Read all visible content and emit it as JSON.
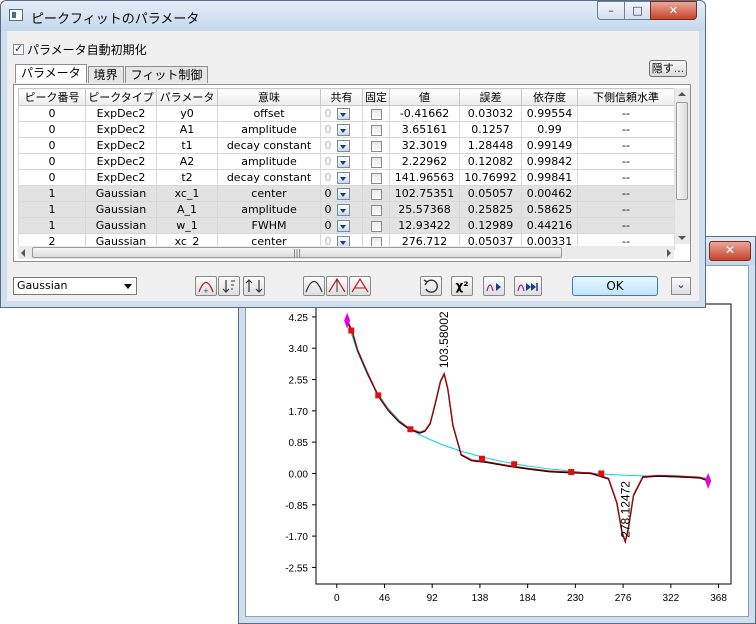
{
  "dialog": {
    "title": "ピークフィットのパラメータ",
    "auto_init_label": "パラメータ自動初期化",
    "hide_label": "隠す...",
    "tabs": [
      "パラメータ",
      "境界",
      "フィット制御"
    ],
    "columns": [
      "ピーク番号",
      "ピークタイプ",
      "パラメータ",
      "意味",
      "共有",
      "固定",
      "値",
      "誤差",
      "依存度",
      "下側信頼水準"
    ],
    "rows": [
      {
        "peak": "0",
        "type": "ExpDec2",
        "param": "y0",
        "meaning": "offset",
        "share": "0",
        "value": "-0.41662",
        "error": "0.03032",
        "dep": "0.99554",
        "lcl": "--",
        "shade": false
      },
      {
        "peak": "0",
        "type": "ExpDec2",
        "param": "A1",
        "meaning": "amplitude",
        "share": "0",
        "value": "3.65161",
        "error": "0.1257",
        "dep": "0.99",
        "lcl": "--",
        "shade": false
      },
      {
        "peak": "0",
        "type": "ExpDec2",
        "param": "t1",
        "meaning": "decay constant",
        "share": "0",
        "value": "32.3019",
        "error": "1.28448",
        "dep": "0.99149",
        "lcl": "--",
        "shade": false
      },
      {
        "peak": "0",
        "type": "ExpDec2",
        "param": "A2",
        "meaning": "amplitude",
        "share": "0",
        "value": "2.22962",
        "error": "0.12082",
        "dep": "0.99842",
        "lcl": "--",
        "shade": false
      },
      {
        "peak": "0",
        "type": "ExpDec2",
        "param": "t2",
        "meaning": "decay constant",
        "share": "0",
        "value": "141.96563",
        "error": "10.76992",
        "dep": "0.99841",
        "lcl": "--",
        "shade": false
      },
      {
        "peak": "1",
        "type": "Gaussian",
        "param": "xc_1",
        "meaning": "center",
        "share": "0",
        "value": "102.75351",
        "error": "0.05057",
        "dep": "0.00462",
        "lcl": "--",
        "shade": true
      },
      {
        "peak": "1",
        "type": "Gaussian",
        "param": "A_1",
        "meaning": "amplitude",
        "share": "0",
        "value": "25.57368",
        "error": "0.25825",
        "dep": "0.58625",
        "lcl": "--",
        "shade": true
      },
      {
        "peak": "1",
        "type": "Gaussian",
        "param": "w_1",
        "meaning": "FWHM",
        "share": "0",
        "value": "12.93422",
        "error": "0.12989",
        "dep": "0.44216",
        "lcl": "--",
        "shade": true
      },
      {
        "peak": "2",
        "type": "Gaussian",
        "param": "xc_2",
        "meaning": "center",
        "share": "0",
        "value": "276.712",
        "error": "0.05037",
        "dep": "0.00331",
        "lcl": "--",
        "shade": false
      }
    ],
    "peak_type_select": "Gaussian",
    "ok_label": "OK",
    "toolbar_icons": [
      "add-peak-icon",
      "sort-icon",
      "rescale-icon",
      "curve-icon",
      "peak-icon",
      "remove-peak-icon",
      "undo-icon",
      "chisq-icon",
      "iterate-icon",
      "fit-until-converge-icon"
    ],
    "chisq_label": "χ²"
  },
  "graph": {
    "y_ticks": [
      "4.25",
      "3.40",
      "2.55",
      "1.70",
      "0.85",
      "0.00",
      "-0.85",
      "-1.70",
      "-2.55"
    ],
    "x_ticks": [
      "0",
      "46",
      "92",
      "138",
      "184",
      "230",
      "276",
      "322",
      "368"
    ],
    "peak_labels": [
      "103.58002",
      "278.12472"
    ],
    "colors": {
      "data": "#000000",
      "fit": "#cc0000",
      "baseline": "#00d6e0",
      "anchor": "#e01010",
      "endpoint": "#e000e0"
    }
  },
  "chart_data": {
    "type": "line",
    "xlim": [
      -20,
      380
    ],
    "ylim": [
      -3.0,
      4.6
    ],
    "series": [
      {
        "name": "",
        "x": [
          10,
          15,
          20,
          30,
          40,
          50,
          60,
          70,
          75,
          80,
          85,
          90,
          95,
          100,
          103.58,
          107,
          112,
          120,
          130,
          145,
          165,
          185,
          205,
          225,
          245,
          262,
          270,
          275,
          278.12,
          281,
          286,
          295,
          310,
          330,
          350,
          358
        ],
        "y": [
          4.15,
          3.85,
          3.35,
          2.7,
          2.1,
          1.7,
          1.4,
          1.2,
          1.15,
          1.1,
          1.15,
          1.35,
          1.9,
          2.5,
          2.7,
          2.3,
          1.3,
          0.5,
          0.35,
          0.3,
          0.2,
          0.12,
          0.05,
          0.02,
          0.0,
          -0.15,
          -0.8,
          -1.6,
          -1.85,
          -1.5,
          -0.6,
          -0.1,
          -0.07,
          -0.09,
          -0.12,
          -0.2
        ]
      },
      {
        "name": "",
        "x": [
          10,
          20,
          30,
          40,
          50,
          60,
          70,
          80,
          90,
          100,
          120,
          140,
          160,
          180,
          200,
          220,
          240,
          260,
          280,
          300,
          330,
          358
        ],
        "y": [
          4.15,
          3.3,
          2.65,
          2.15,
          1.75,
          1.45,
          1.22,
          1.05,
          0.92,
          0.8,
          0.6,
          0.45,
          0.32,
          0.22,
          0.14,
          0.08,
          0.02,
          -0.02,
          -0.05,
          -0.07,
          -0.1,
          -0.12
        ]
      }
    ],
    "anchors": {
      "x": [
        14,
        40,
        71,
        140,
        171,
        226,
        255
      ],
      "y": [
        3.88,
        2.12,
        1.2,
        0.4,
        0.25,
        0.04,
        0.0
      ]
    },
    "endpoints": {
      "x": [
        10,
        358
      ],
      "y": [
        4.15,
        -0.2
      ]
    }
  }
}
